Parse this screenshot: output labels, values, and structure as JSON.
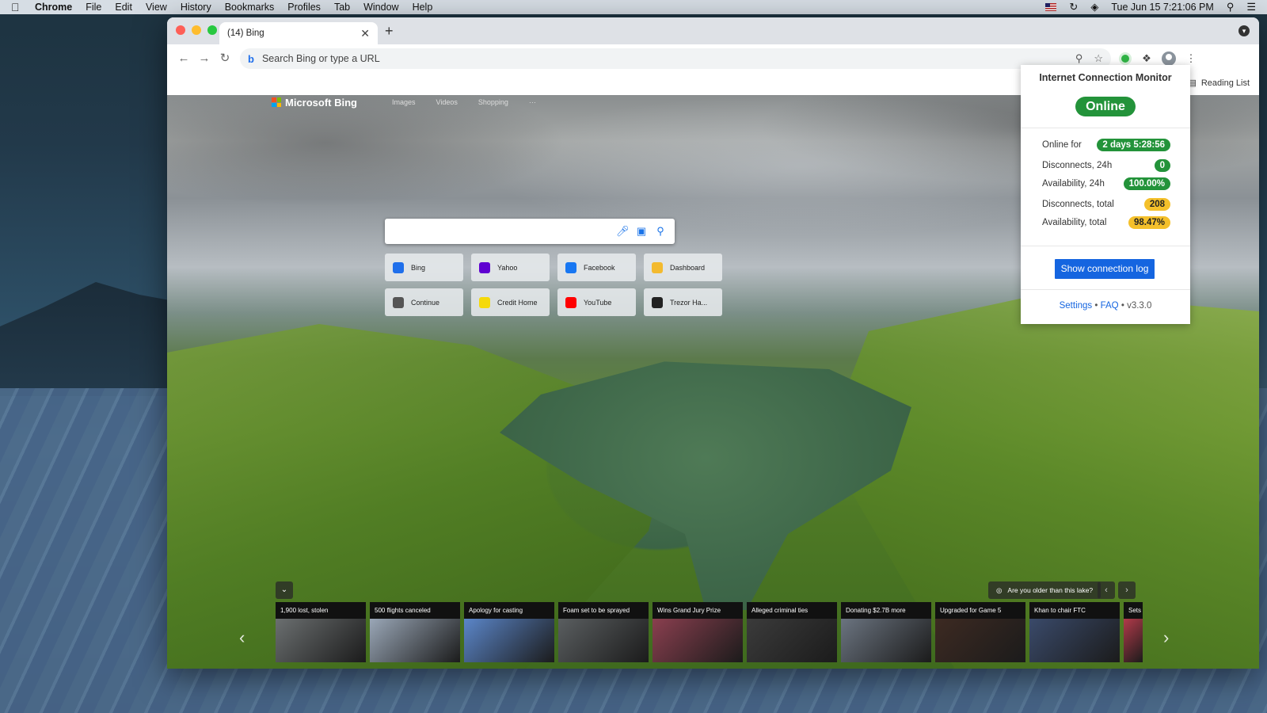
{
  "menubar": {
    "app_name": "Chrome",
    "items": [
      "File",
      "Edit",
      "View",
      "History",
      "Bookmarks",
      "Profiles",
      "Tab",
      "Window",
      "Help"
    ],
    "datetime": "Tue Jun 15  7:21:06 PM"
  },
  "browser": {
    "tab_title": "(14) Bing",
    "address_placeholder": "Search Bing or type a URL",
    "reading_list": "Reading List"
  },
  "bing": {
    "logo_text": "Microsoft Bing",
    "nav": [
      "Images",
      "Videos",
      "Shopping",
      "···"
    ],
    "tiles": [
      {
        "label": "Bing",
        "icon": "bing-icon",
        "color": "#1f6feb"
      },
      {
        "label": "Yahoo",
        "icon": "yahoo-icon",
        "color": "#5f01d1"
      },
      {
        "label": "Facebook",
        "icon": "facebook-icon",
        "color": "#1877f2"
      },
      {
        "label": "Dashboard",
        "icon": "binance-icon",
        "color": "#f3ba2f"
      },
      {
        "label": "Continue",
        "icon": "continue-icon",
        "color": "#555555"
      },
      {
        "label": "Credit Home",
        "icon": "credit-home-icon",
        "color": "#f5d90a"
      },
      {
        "label": "YouTube",
        "icon": "youtube-icon",
        "color": "#ff0000"
      },
      {
        "label": "Trezor Ha...",
        "icon": "trezor-icon",
        "color": "#222222"
      }
    ],
    "lake_question": "Are you older than this lake?",
    "news": [
      {
        "title": "1,900 lost, stolen",
        "color": "#6b6f70"
      },
      {
        "title": "500 flights canceled",
        "color": "#9aa7b7"
      },
      {
        "title": "Apology for casting",
        "color": "#5b86c9"
      },
      {
        "title": "Foam set to be sprayed",
        "color": "#5a5e60"
      },
      {
        "title": "Wins Grand Jury Prize",
        "color": "#8a3f4f"
      },
      {
        "title": "Alleged criminal ties",
        "color": "#3b3b3b"
      },
      {
        "title": "Donating $2.7B more",
        "color": "#6b7480"
      },
      {
        "title": "Upgraded for Game 5",
        "color": "#3d2a22"
      },
      {
        "title": "Khan to chair FTC",
        "color": "#3a4a6a"
      },
      {
        "title": "Sets",
        "color": "#b23a4a"
      }
    ]
  },
  "monitor": {
    "title": "Internet Connection Monitor",
    "status": "Online",
    "stats": [
      {
        "label": "Online for",
        "value": "2 days 5:28:56",
        "tone": "green"
      },
      {
        "label": "Disconnects, 24h",
        "value": "0",
        "tone": "green"
      },
      {
        "label": "Availability, 24h",
        "value": "100.00%",
        "tone": "green"
      },
      {
        "label": "Disconnects, total",
        "value": "208",
        "tone": "amber"
      },
      {
        "label": "Availability, total",
        "value": "98.47%",
        "tone": "amber"
      }
    ],
    "log_button": "Show connection log",
    "settings_link": "Settings",
    "faq_link": "FAQ",
    "version": "v3.3.0",
    "separator": "•"
  }
}
